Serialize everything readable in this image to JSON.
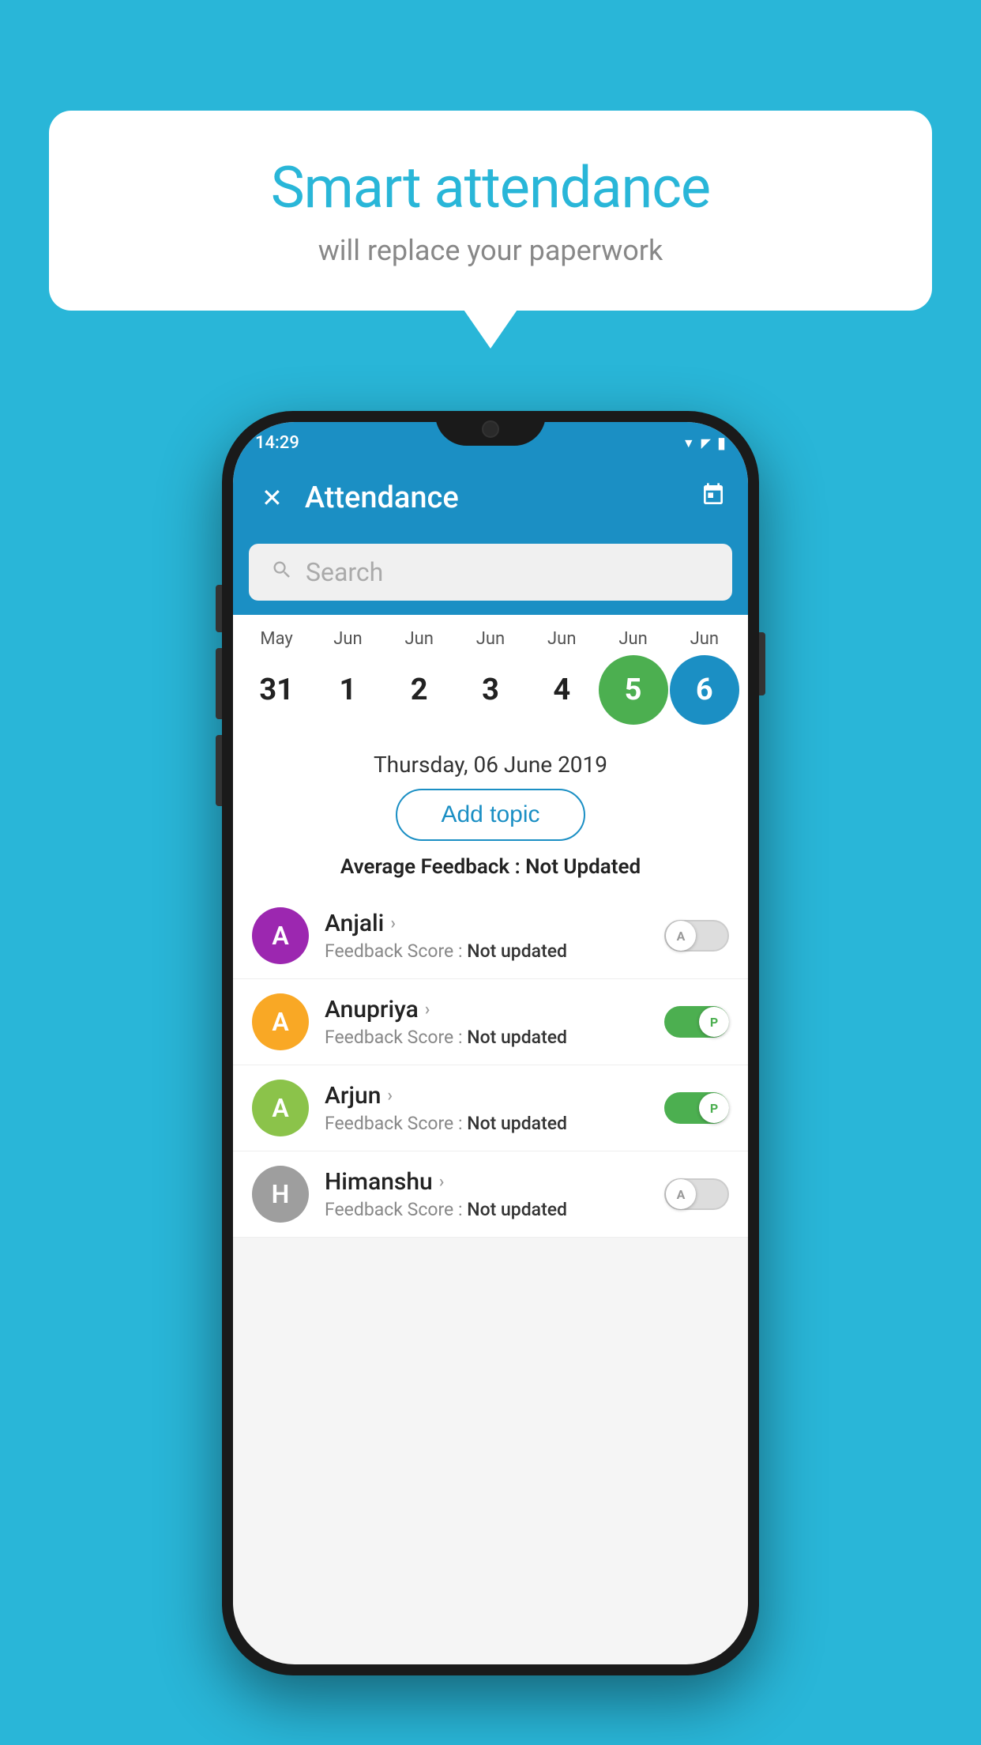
{
  "background_color": "#29b6d8",
  "speech_bubble": {
    "title": "Smart attendance",
    "subtitle": "will replace your paperwork"
  },
  "phone": {
    "status_bar": {
      "time": "14:29",
      "icons": [
        "wifi",
        "signal",
        "battery"
      ]
    },
    "app_bar": {
      "close_label": "✕",
      "title": "Attendance",
      "calendar_icon": "📅"
    },
    "search": {
      "placeholder": "Search"
    },
    "calendar": {
      "months": [
        "May",
        "Jun",
        "Jun",
        "Jun",
        "Jun",
        "Jun",
        "Jun"
      ],
      "dates": [
        31,
        1,
        2,
        3,
        4,
        5,
        6
      ],
      "today_index": 5,
      "selected_index": 6
    },
    "selected_date_label": "Thursday, 06 June 2019",
    "add_topic_label": "Add topic",
    "avg_feedback_label": "Average Feedback : ",
    "avg_feedback_value": "Not Updated",
    "students": [
      {
        "name": "Anjali",
        "avatar_letter": "A",
        "avatar_color": "#9c27b0",
        "feedback_label": "Feedback Score : ",
        "feedback_value": "Not updated",
        "toggle_state": "off",
        "toggle_label": "A"
      },
      {
        "name": "Anupriya",
        "avatar_letter": "A",
        "avatar_color": "#f9a825",
        "feedback_label": "Feedback Score : ",
        "feedback_value": "Not updated",
        "toggle_state": "on",
        "toggle_label": "P"
      },
      {
        "name": "Arjun",
        "avatar_letter": "A",
        "avatar_color": "#8bc34a",
        "feedback_label": "Feedback Score : ",
        "feedback_value": "Not updated",
        "toggle_state": "on",
        "toggle_label": "P"
      },
      {
        "name": "Himanshu",
        "avatar_letter": "H",
        "avatar_color": "#9e9e9e",
        "feedback_label": "Feedback Score : ",
        "feedback_value": "Not updated",
        "toggle_state": "off",
        "toggle_label": "A"
      }
    ]
  }
}
